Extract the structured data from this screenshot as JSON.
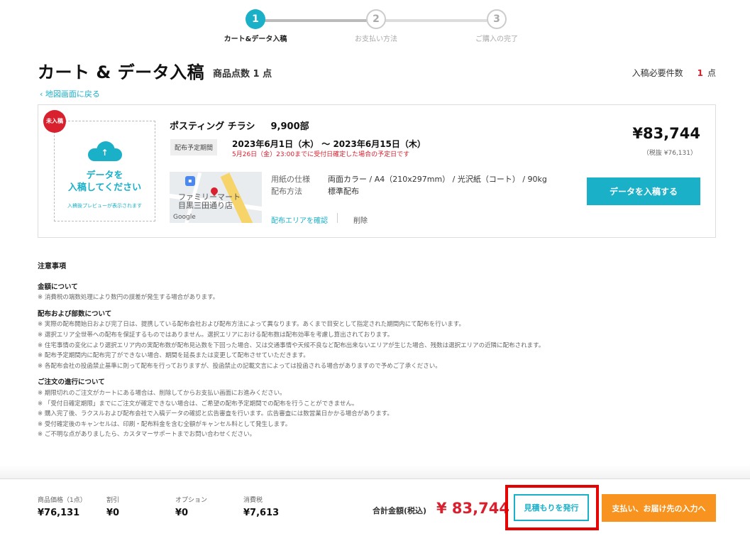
{
  "stepper": {
    "steps": [
      {
        "number": "1",
        "label": "カート&データ入稿",
        "state": "active"
      },
      {
        "number": "2",
        "label": "お支払い方法",
        "state": "inactive"
      },
      {
        "number": "3",
        "label": "ご購入の完了",
        "state": "inactive"
      }
    ]
  },
  "header": {
    "title": "カート & データ入稿",
    "item_count": "商品点数 1 点",
    "required_label": "入稿必要件数",
    "required_num": "1",
    "required_unit": "点",
    "back_link": "‹ 地図画面に戻る"
  },
  "cart_item": {
    "badge": "未入稿",
    "upload_text_line1": "データを",
    "upload_text_line2": "入稿してください",
    "upload_sub": "入稿後プレビューが表示されます",
    "product_name": "ポスティング チラシ",
    "product_qty": "9,900部",
    "period_tag": "配布予定期間",
    "period_dates": "2023年6月1日（木） ～ 2023年6月15日（木）",
    "period_note": "5月26日（金）23:00までに受付日確定した場合の予定日です",
    "map_label_line1": "ファミリーマート",
    "map_label_line2": "目黒三田通り店",
    "map_brand": "Google",
    "specs": [
      {
        "key": "用紙の仕様",
        "value": "両面カラー / A4（210x297mm） / 光沢紙（コート） / 90kg"
      },
      {
        "key": "配布方法",
        "value": "標準配布"
      }
    ],
    "area_link": "配布エリアを確認",
    "delete_link": "削除",
    "price": "¥83,744",
    "price_excl": "（税抜 ¥76,131）",
    "upload_button": "データを入稿する"
  },
  "notes": {
    "title": "注意事項",
    "sections": [
      {
        "heading": "金額について",
        "lines": [
          "※ 消費税の端数処理により数円の誤差が発生する場合があります。"
        ]
      },
      {
        "heading": "配布および部数について",
        "lines": [
          "※ 実際の配布開始日および完了日は、提携している配布会社および配布方法によって異なります。あくまで目安として指定された期間内にて配布を行います。",
          "※ 選択エリア全世帯への配布を保証するものではありません。選択エリアにおける配布数は配布効率を考慮し算出されております。",
          "※ 住宅事情の変化により選択エリア内の実配布数が配布見込数を下回った場合、又は交通事情や天候不良など配布出来ないエリアが生じた場合、残数は選択エリアの近隣に配布されます。",
          "※ 配布予定期間内に配布完了ができない場合、期間を延長または変更して配布させていただきます。",
          "※ 各配布会社の投函禁止基準に則って配布を行っておりますが、投函禁止の記載文言によっては投函される場合がありますので予めご了承ください。"
        ]
      },
      {
        "heading": "ご注文の進行について",
        "lines": [
          "※ 期限切れのご注文がカートにある場合は、削除してからお支払い画面にお進みください。",
          "※ 「受付日確定期限」までにご注文が確定できない場合は、ご希望の配布予定期間での配布を行うことができません。",
          "※ 購入完了後、ラクスルおよび配布会社で入稿データの確認と広告審査を行います。広告審査には数営業日かかる場合があります。",
          "※ 受付確定後のキャンセルは、印刷・配布料金を含む全額がキャンセル料として発生します。",
          "※ ご不明な点がありましたら、カスタマーサポートまでお問い合わせください。"
        ]
      }
    ]
  },
  "footer": {
    "summary": [
      {
        "label": "商品価格（1点）",
        "value": "¥76,131"
      },
      {
        "label": "割引",
        "value": "¥0"
      },
      {
        "label": "オプション",
        "value": "¥0"
      },
      {
        "label": "消費税",
        "value": "¥7,613"
      }
    ],
    "total_label": "合計金額(税込)",
    "total_value": "¥ 83,744",
    "estimate_button": "見積もりを発行",
    "checkout_button": "支払い、お届け先の入力へ"
  },
  "colors": {
    "accent": "#1ab0c8",
    "alert": "#d8202f",
    "checkout": "#f7931e",
    "highlight": "#e60000"
  }
}
